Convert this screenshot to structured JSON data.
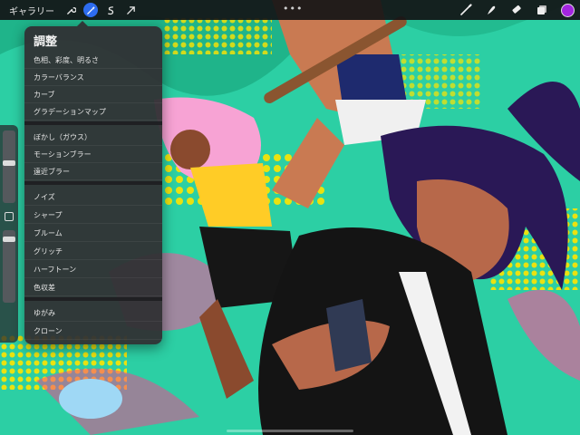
{
  "toolbar": {
    "gallery_label": "ギャラリー",
    "more_label": "•••",
    "left_tools": [
      "wrench-icon",
      "magic-wand-icon",
      "selection-icon",
      "transform-arrow-icon"
    ],
    "right_tools": [
      "brush-icon",
      "smudge-icon",
      "eraser-icon",
      "layers-icon"
    ],
    "current_color": "#a325e0",
    "accent": "#2d6cf0"
  },
  "panel": {
    "title": "調整",
    "items": [
      "色相、彩度、明るさ",
      "カラーバランス",
      "カーブ",
      "グラデーションマップ",
      "ぼかし（ガウス）",
      "モーションブラー",
      "遠近ブラー",
      "ノイズ",
      "シャープ",
      "ブルーム",
      "グリッチ",
      "ハーフトーン",
      "色収差",
      "ゆがみ",
      "クローン"
    ]
  },
  "sidebar": {
    "brush_size_level": 0.45,
    "opacity_level": 0.1
  }
}
